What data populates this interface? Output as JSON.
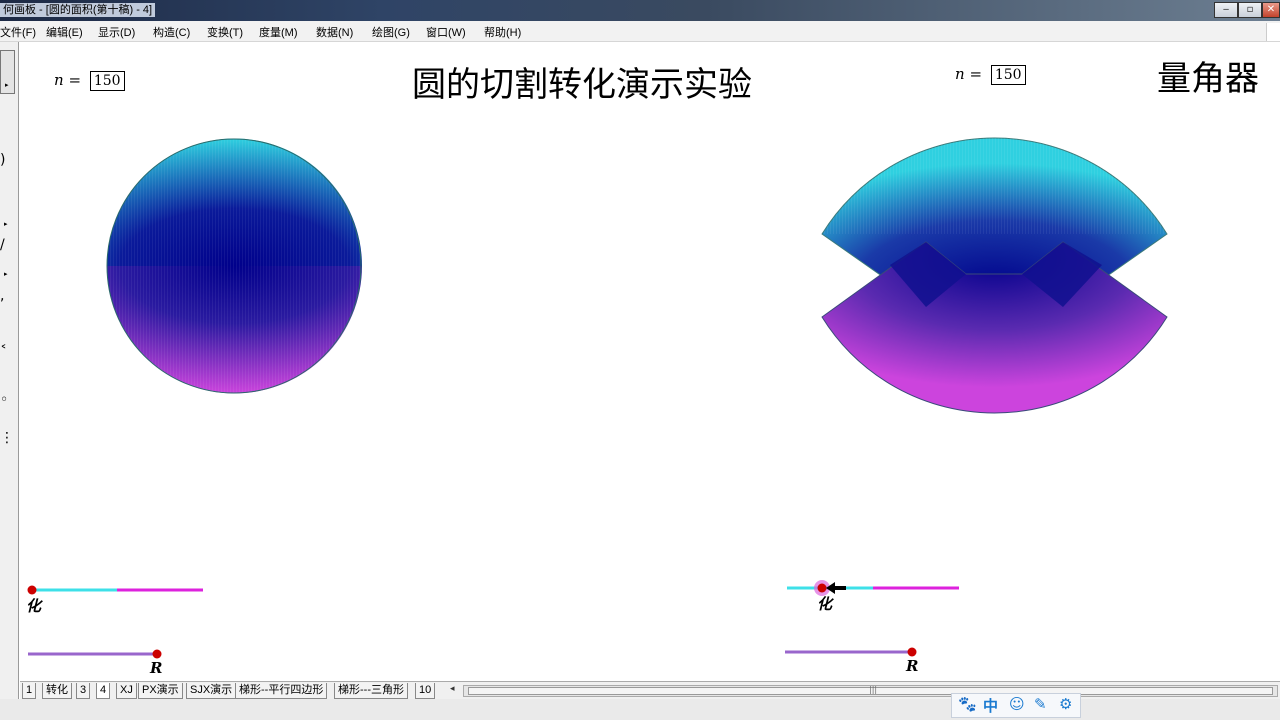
{
  "window": {
    "title": "何画板 - [圆的面积(第十稿) - 4]",
    "controls": {
      "minimize": "‒",
      "maximize": "▫",
      "close": "✕"
    }
  },
  "menubar": {
    "items": [
      "文件(F)",
      "编辑(E)",
      "显示(D)",
      "构造(C)",
      "变换(T)",
      "度量(M)",
      "数据(N)",
      "绘图(G)",
      "窗口(W)",
      "帮助(H)"
    ]
  },
  "canvas": {
    "title": "圆的切割转化演示实验",
    "protractor_label": "量角器",
    "left_param": {
      "var": "n",
      "eq": "=",
      "value": "150"
    },
    "right_param": {
      "var": "n",
      "eq": "=",
      "value": "150"
    },
    "left_slider_label": "化",
    "left_radius_label": "R",
    "right_slider_label": "化",
    "right_radius_label": "R",
    "colors": {
      "upper_fan": "#2fd0e0",
      "lower_fan": "#cc44dd",
      "center": "#00008b",
      "slider_cyan": "#3ee0e8",
      "slider_magenta": "#dd22dd",
      "radius_line": "#9966cc",
      "point": "#cc0000"
    }
  },
  "tabs": {
    "items": [
      "1",
      "转化",
      "3",
      "4",
      "XJ",
      "PX演示",
      "SJX演示",
      "梯形--平行四边形",
      "梯形---三角形",
      "10"
    ],
    "active": "4",
    "scroll_left": "◂",
    "grip": "|||"
  },
  "ime": {
    "items": [
      "🐾",
      "中",
      "☺",
      "✎",
      "⚙"
    ]
  }
}
